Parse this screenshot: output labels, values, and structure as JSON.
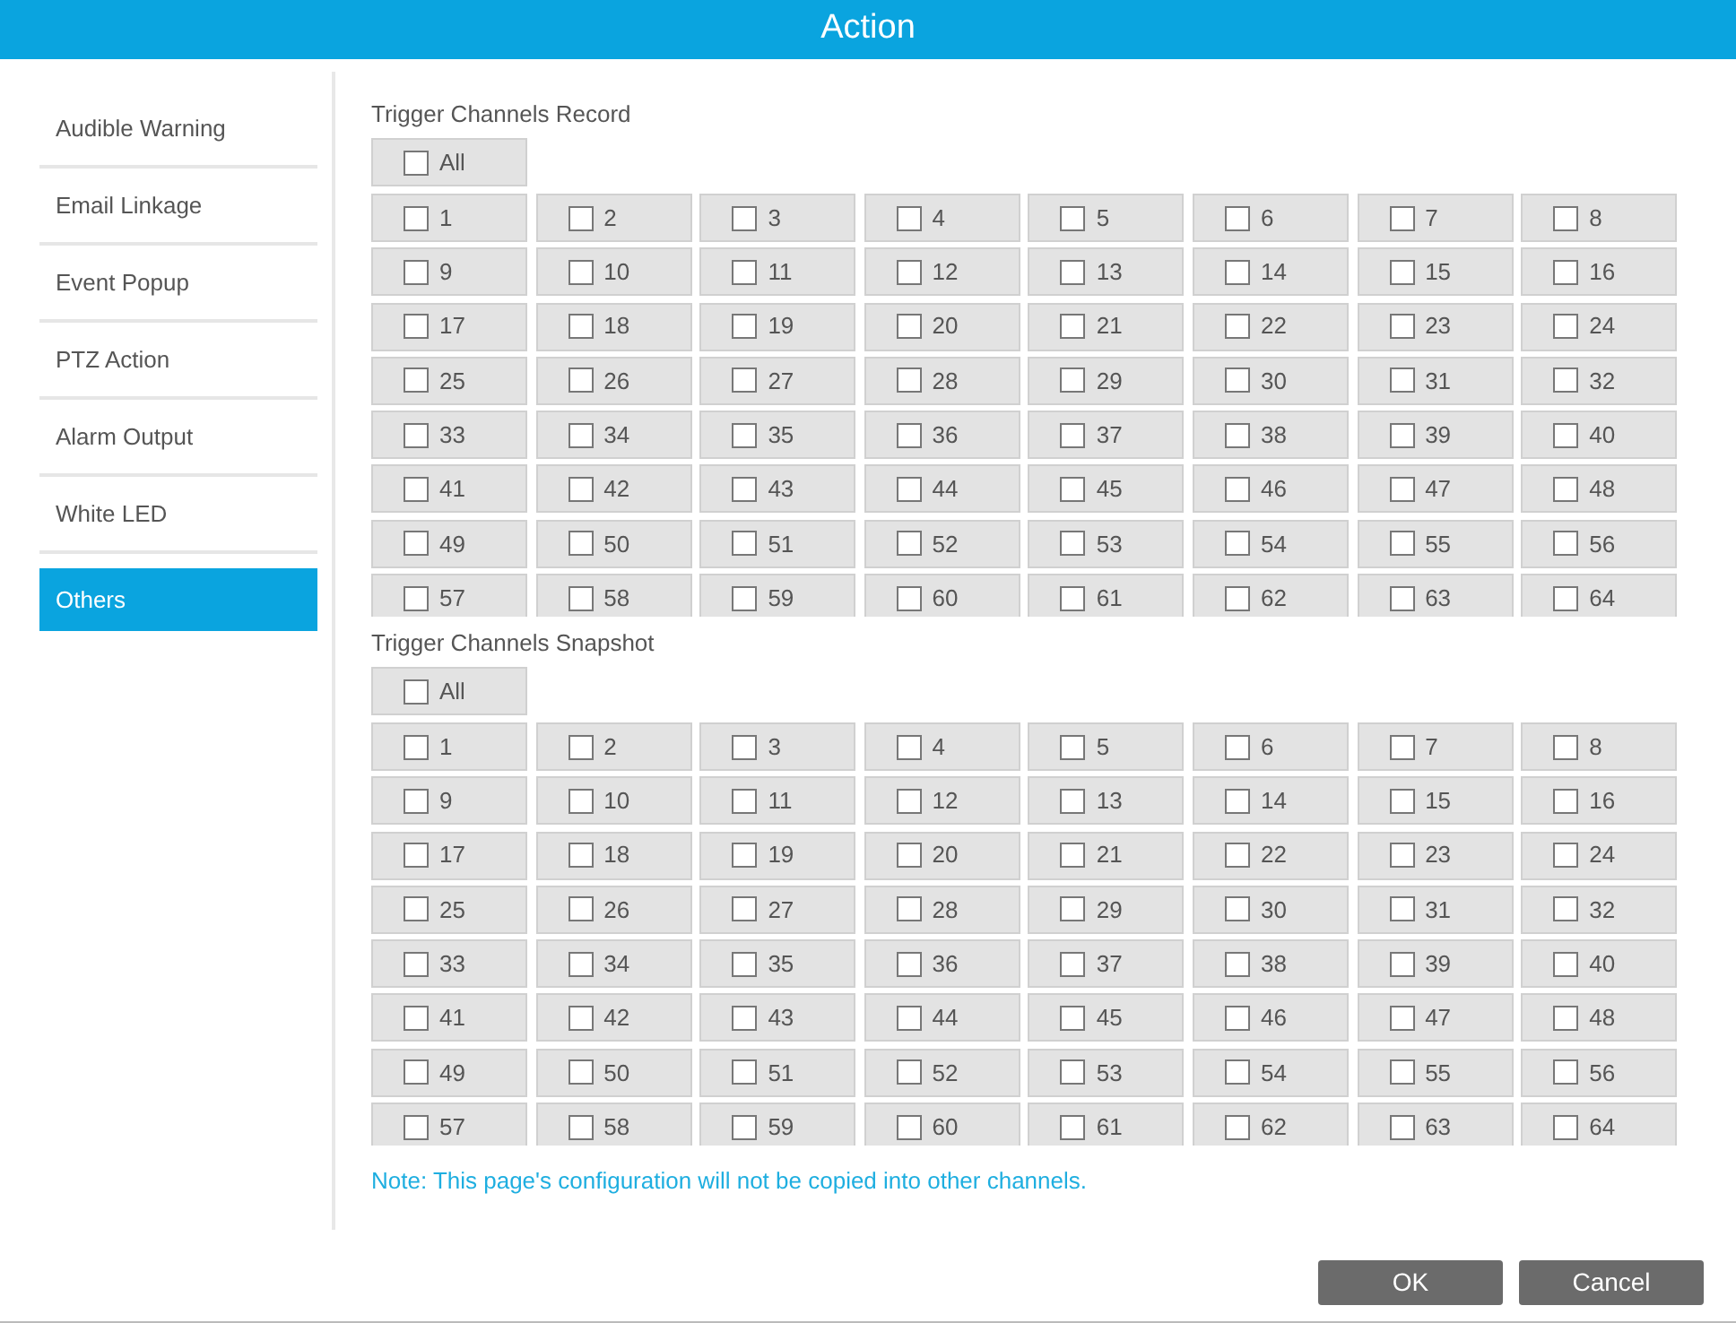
{
  "window": {
    "title": "Action"
  },
  "sidebar": {
    "items": [
      {
        "label": "Audible Warning",
        "selected": false
      },
      {
        "label": "Email Linkage",
        "selected": false
      },
      {
        "label": "Event Popup",
        "selected": false
      },
      {
        "label": "PTZ Action",
        "selected": false
      },
      {
        "label": "Alarm Output",
        "selected": false
      },
      {
        "label": "White LED",
        "selected": false
      },
      {
        "label": "Others",
        "selected": true
      }
    ]
  },
  "sections": [
    {
      "title": "Trigger Channels Record",
      "all": {
        "label": "All",
        "checked": false
      },
      "channels": [
        {
          "label": "1",
          "checked": false
        },
        {
          "label": "2",
          "checked": false
        },
        {
          "label": "3",
          "checked": false
        },
        {
          "label": "4",
          "checked": false
        },
        {
          "label": "5",
          "checked": false
        },
        {
          "label": "6",
          "checked": false
        },
        {
          "label": "7",
          "checked": false
        },
        {
          "label": "8",
          "checked": false
        },
        {
          "label": "9",
          "checked": false
        },
        {
          "label": "10",
          "checked": false
        },
        {
          "label": "11",
          "checked": false
        },
        {
          "label": "12",
          "checked": false
        },
        {
          "label": "13",
          "checked": false
        },
        {
          "label": "14",
          "checked": false
        },
        {
          "label": "15",
          "checked": false
        },
        {
          "label": "16",
          "checked": false
        },
        {
          "label": "17",
          "checked": false
        },
        {
          "label": "18",
          "checked": false
        },
        {
          "label": "19",
          "checked": false
        },
        {
          "label": "20",
          "checked": false
        },
        {
          "label": "21",
          "checked": false
        },
        {
          "label": "22",
          "checked": false
        },
        {
          "label": "23",
          "checked": false
        },
        {
          "label": "24",
          "checked": false
        },
        {
          "label": "25",
          "checked": false
        },
        {
          "label": "26",
          "checked": false
        },
        {
          "label": "27",
          "checked": false
        },
        {
          "label": "28",
          "checked": false
        },
        {
          "label": "29",
          "checked": false
        },
        {
          "label": "30",
          "checked": false
        },
        {
          "label": "31",
          "checked": false
        },
        {
          "label": "32",
          "checked": false
        },
        {
          "label": "33",
          "checked": false
        },
        {
          "label": "34",
          "checked": false
        },
        {
          "label": "35",
          "checked": false
        },
        {
          "label": "36",
          "checked": false
        },
        {
          "label": "37",
          "checked": false
        },
        {
          "label": "38",
          "checked": false
        },
        {
          "label": "39",
          "checked": false
        },
        {
          "label": "40",
          "checked": false
        },
        {
          "label": "41",
          "checked": false
        },
        {
          "label": "42",
          "checked": false
        },
        {
          "label": "43",
          "checked": false
        },
        {
          "label": "44",
          "checked": false
        },
        {
          "label": "45",
          "checked": false
        },
        {
          "label": "46",
          "checked": false
        },
        {
          "label": "47",
          "checked": false
        },
        {
          "label": "48",
          "checked": false
        },
        {
          "label": "49",
          "checked": false
        },
        {
          "label": "50",
          "checked": false
        },
        {
          "label": "51",
          "checked": false
        },
        {
          "label": "52",
          "checked": false
        },
        {
          "label": "53",
          "checked": false
        },
        {
          "label": "54",
          "checked": false
        },
        {
          "label": "55",
          "checked": false
        },
        {
          "label": "56",
          "checked": false
        },
        {
          "label": "57",
          "checked": false
        },
        {
          "label": "58",
          "checked": false
        },
        {
          "label": "59",
          "checked": false
        },
        {
          "label": "60",
          "checked": false
        },
        {
          "label": "61",
          "checked": false
        },
        {
          "label": "62",
          "checked": false
        },
        {
          "label": "63",
          "checked": false
        },
        {
          "label": "64",
          "checked": false
        }
      ]
    },
    {
      "title": "Trigger Channels Snapshot",
      "all": {
        "label": "All",
        "checked": false
      },
      "channels": [
        {
          "label": "1",
          "checked": false
        },
        {
          "label": "2",
          "checked": false
        },
        {
          "label": "3",
          "checked": false
        },
        {
          "label": "4",
          "checked": false
        },
        {
          "label": "5",
          "checked": false
        },
        {
          "label": "6",
          "checked": false
        },
        {
          "label": "7",
          "checked": false
        },
        {
          "label": "8",
          "checked": false
        },
        {
          "label": "9",
          "checked": false
        },
        {
          "label": "10",
          "checked": false
        },
        {
          "label": "11",
          "checked": false
        },
        {
          "label": "12",
          "checked": false
        },
        {
          "label": "13",
          "checked": false
        },
        {
          "label": "14",
          "checked": false
        },
        {
          "label": "15",
          "checked": false
        },
        {
          "label": "16",
          "checked": false
        },
        {
          "label": "17",
          "checked": false
        },
        {
          "label": "18",
          "checked": false
        },
        {
          "label": "19",
          "checked": false
        },
        {
          "label": "20",
          "checked": false
        },
        {
          "label": "21",
          "checked": false
        },
        {
          "label": "22",
          "checked": false
        },
        {
          "label": "23",
          "checked": false
        },
        {
          "label": "24",
          "checked": false
        },
        {
          "label": "25",
          "checked": false
        },
        {
          "label": "26",
          "checked": false
        },
        {
          "label": "27",
          "checked": false
        },
        {
          "label": "28",
          "checked": false
        },
        {
          "label": "29",
          "checked": false
        },
        {
          "label": "30",
          "checked": false
        },
        {
          "label": "31",
          "checked": false
        },
        {
          "label": "32",
          "checked": false
        },
        {
          "label": "33",
          "checked": false
        },
        {
          "label": "34",
          "checked": false
        },
        {
          "label": "35",
          "checked": false
        },
        {
          "label": "36",
          "checked": false
        },
        {
          "label": "37",
          "checked": false
        },
        {
          "label": "38",
          "checked": false
        },
        {
          "label": "39",
          "checked": false
        },
        {
          "label": "40",
          "checked": false
        },
        {
          "label": "41",
          "checked": false
        },
        {
          "label": "42",
          "checked": false
        },
        {
          "label": "43",
          "checked": false
        },
        {
          "label": "44",
          "checked": false
        },
        {
          "label": "45",
          "checked": false
        },
        {
          "label": "46",
          "checked": false
        },
        {
          "label": "47",
          "checked": false
        },
        {
          "label": "48",
          "checked": false
        },
        {
          "label": "49",
          "checked": false
        },
        {
          "label": "50",
          "checked": false
        },
        {
          "label": "51",
          "checked": false
        },
        {
          "label": "52",
          "checked": false
        },
        {
          "label": "53",
          "checked": false
        },
        {
          "label": "54",
          "checked": false
        },
        {
          "label": "55",
          "checked": false
        },
        {
          "label": "56",
          "checked": false
        },
        {
          "label": "57",
          "checked": false
        },
        {
          "label": "58",
          "checked": false
        },
        {
          "label": "59",
          "checked": false
        },
        {
          "label": "60",
          "checked": false
        },
        {
          "label": "61",
          "checked": false
        },
        {
          "label": "62",
          "checked": false
        },
        {
          "label": "63",
          "checked": false
        },
        {
          "label": "64",
          "checked": false
        }
      ]
    }
  ],
  "note": "Note: This page's configuration will not be copied into other channels.",
  "buttons": [
    {
      "label": "OK"
    },
    {
      "label": "Cancel"
    }
  ]
}
